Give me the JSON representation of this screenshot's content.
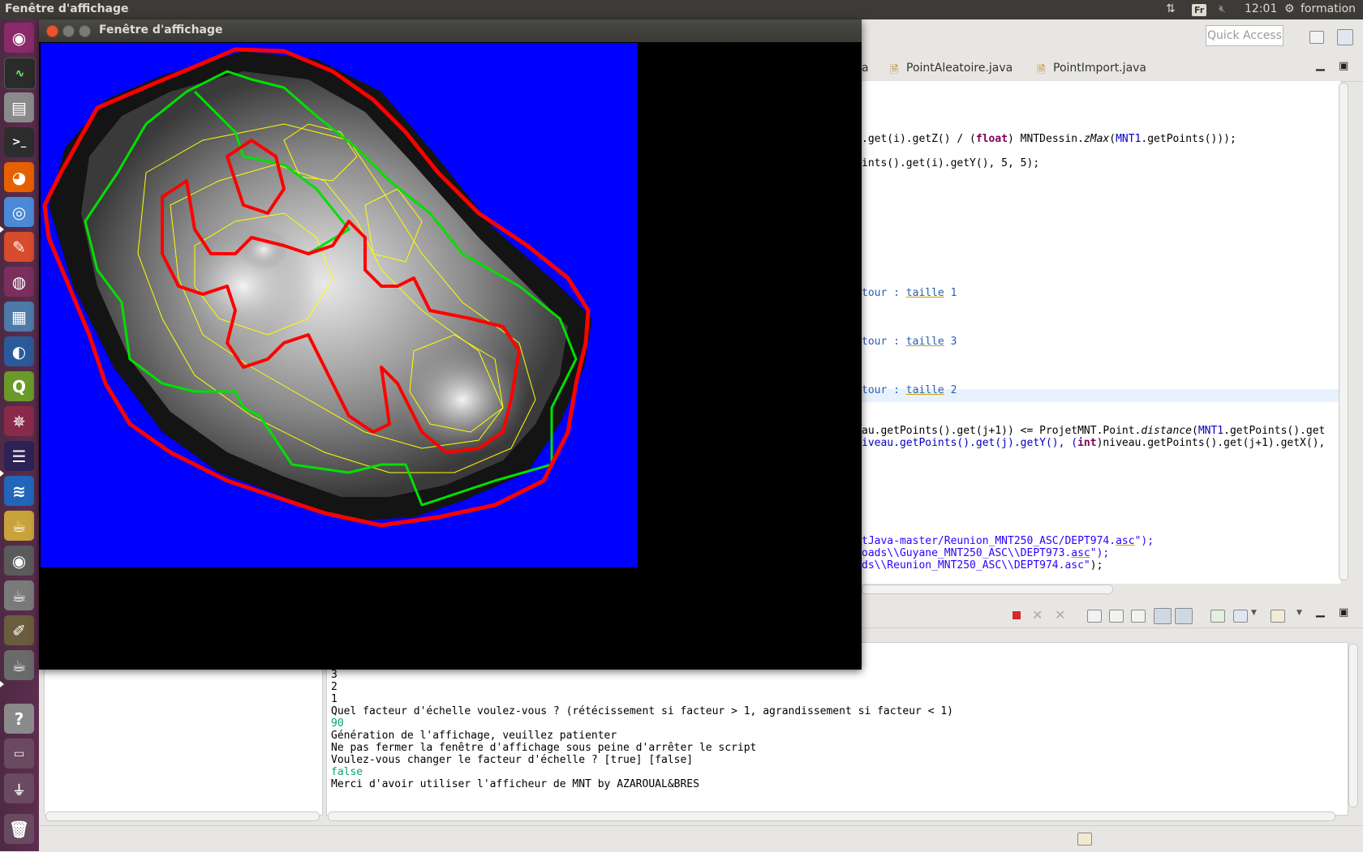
{
  "top_panel": {
    "title": "Fenêtre d'affichage",
    "keyboard": "Fr",
    "time": "12:01",
    "user": "formation"
  },
  "launcher": {
    "items": [
      "ubuntu-dash",
      "system-monitor",
      "files",
      "terminal",
      "firefox",
      "chromium",
      "settings",
      "system",
      "image-viewer",
      "browser",
      "qgis",
      "network",
      "eclipse",
      "monitor",
      "vlc",
      "eye",
      "java",
      "gimp",
      "java2",
      "help",
      "drive",
      "usb",
      "trash"
    ]
  },
  "eclipse": {
    "quick_access": "Quick Access",
    "tabs": [
      "a",
      "PointAleatoire.java",
      "PointImport.java"
    ],
    "code": {
      "l1_a": ".get(i).getZ() / (",
      "l1_kw": "float",
      "l1_b": ") MNTDessin.",
      "l1_it": "zMax",
      "l1_c": "(",
      "l1_fld": "MNT1",
      "l1_d": ".getPoints()));",
      "l2": "ints().get(i).getY(), 5, 5);",
      "l3_a": "tour : ",
      "l3_b": "taille",
      "l3_c": " 1",
      "l4_a": "tour : ",
      "l4_b": "taille",
      "l4_c": " 3",
      "l5_a": "tour : ",
      "l5_b": "taille",
      "l5_c": " 2",
      "l6_a": "au.getPoints().get(j+1)) <= ProjetMNT.Point.",
      "l6_it": "distance",
      "l6_b": "(",
      "l6_fld": "MNT1",
      "l6_c": ".getPoints().get",
      "l7_a": "iveau.getPoints().get(j).getY(), (",
      "l7_kw": "int",
      "l7_b": ")niveau.getPoints().get(j+1).getX(),",
      "l8_a": "tJava-master/Reunion_MNT250_ASC/DEPT974.",
      "l8_b": "asc",
      "l8_c": "\");",
      "l9_a": "oads\\\\Guyane_MNT250_ASC\\\\DEPT973.",
      "l9_b": "asc",
      "l9_c": "\");",
      "l10_a": "ds\\\\Reunion_MNT250_ASC\\\\DEPT974.asc\"",
      "l10_b": ");"
    }
  },
  "console": {
    "lines": [
      {
        "text": "3",
        "input": false
      },
      {
        "text": "2",
        "input": false
      },
      {
        "text": "1",
        "input": false
      },
      {
        "text": "Quel facteur d'échelle voulez-vous ? (rétécissement si facteur > 1, agrandissement si facteur < 1)",
        "input": false
      },
      {
        "text": "90",
        "input": true
      },
      {
        "text": "Génération de l'affichage, veuillez patienter",
        "input": false
      },
      {
        "text": "Ne pas fermer la fenêtre d'affichage sous peine d'arrêter le script",
        "input": false
      },
      {
        "text": "Voulez-vous changer le facteur d'échelle ? [true] [false]",
        "input": false
      },
      {
        "text": "false",
        "input": true
      },
      {
        "text": "Merci d'avoir utiliser l'afficheur de MNT by AZAROUAL&BRES",
        "input": false
      }
    ]
  },
  "display_window": {
    "title": "Fenêtre d'affichage",
    "colors": {
      "background": "#0000ff",
      "coast_contour": "#ff0000",
      "level2_contour": "#00e000",
      "thin_contour": "#ffff00"
    }
  }
}
